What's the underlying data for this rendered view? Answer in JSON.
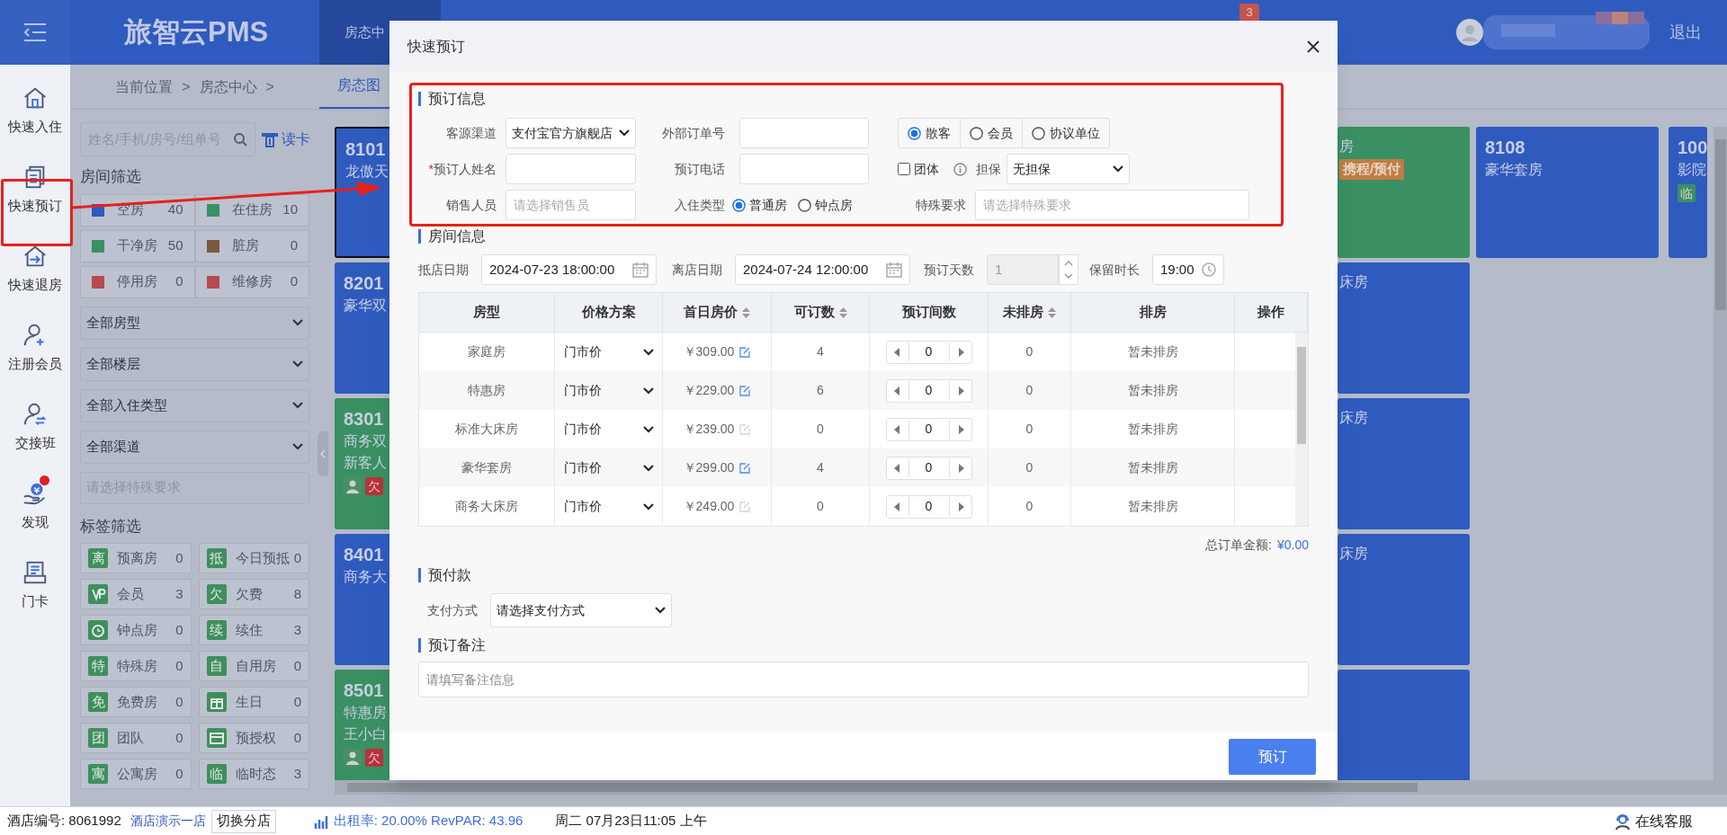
{
  "header": {
    "logo": "旅智云PMS",
    "tab": "房态中",
    "badge": "3",
    "logout": "退出"
  },
  "nav": [
    {
      "label": "快速入住",
      "dot": false
    },
    {
      "label": "快速预订",
      "dot": false
    },
    {
      "label": "快速退房",
      "dot": false
    },
    {
      "label": "注册会员",
      "dot": false
    },
    {
      "label": "交接班",
      "dot": false
    },
    {
      "label": "发现",
      "dot": true
    },
    {
      "label": "门卡",
      "dot": false
    }
  ],
  "filter": {
    "breadcrumb": [
      "当前位置",
      ">",
      "房态中心",
      ">"
    ],
    "search_placeholder": "姓名/手机/房号/组单号",
    "read_card": "读卡",
    "room_filter_title": "房间筛选",
    "statuses": [
      {
        "label": "空房",
        "count": "40",
        "color": "#2f5bbf"
      },
      {
        "label": "在住房",
        "count": "10",
        "color": "#3a9063"
      },
      {
        "label": "干净房",
        "count": "50",
        "color": "#3a9063"
      },
      {
        "label": "脏房",
        "count": "0",
        "color": "#7a5a3c"
      },
      {
        "label": "停用房",
        "count": "0",
        "color": "#b84a4f"
      },
      {
        "label": "维修房",
        "count": "0",
        "color": "#b84a4f"
      }
    ],
    "dropdowns": [
      "全部房型",
      "全部楼层",
      "全部入住类型",
      "全部渠道"
    ],
    "special_placeholder": "请选择特殊要求",
    "tag_filter_title": "标签筛选",
    "tags": [
      {
        "kind": "glyph",
        "glyph": "离",
        "label": "预离房",
        "count": "0"
      },
      {
        "kind": "glyph",
        "glyph": "抵",
        "label": "今日预抵",
        "count": "0"
      },
      {
        "kind": "vip",
        "label": "会员",
        "count": "3"
      },
      {
        "kind": "glyph",
        "glyph": "欠",
        "label": "欠费",
        "count": "8"
      },
      {
        "kind": "clock",
        "label": "钟点房",
        "count": "0"
      },
      {
        "kind": "glyph",
        "glyph": "续",
        "label": "续住",
        "count": "3"
      },
      {
        "kind": "glyph",
        "glyph": "特",
        "label": "特殊房",
        "count": "0"
      },
      {
        "kind": "glyph",
        "glyph": "自",
        "label": "自用房",
        "count": "0"
      },
      {
        "kind": "glyph",
        "glyph": "免",
        "label": "免费房",
        "count": "0"
      },
      {
        "kind": "gift",
        "label": "生日",
        "count": "0"
      },
      {
        "kind": "glyph",
        "glyph": "团",
        "label": "团队",
        "count": "0"
      },
      {
        "kind": "card",
        "label": "预授权",
        "count": "0"
      },
      {
        "kind": "glyph",
        "glyph": "寓",
        "label": "公寓房",
        "count": "0"
      },
      {
        "kind": "glyph",
        "glyph": "临",
        "label": "临时态",
        "count": "3"
      }
    ]
  },
  "room_view_tab": "房态图",
  "room_columns": [
    [
      {
        "number": "8101",
        "lines": [
          "龙傲天"
        ],
        "occupied": false,
        "selected": true
      },
      {
        "number": "8201",
        "lines": [
          "豪华双"
        ],
        "occupied": false,
        "selected": false
      },
      {
        "number": "8301",
        "lines": [
          "商务双",
          "新客人"
        ],
        "occupied": true,
        "selected": false,
        "tags": [
          {
            "kind": "guest",
            "color": "#4a8f66"
          },
          {
            "kind": "glyph",
            "glyph": "欠",
            "color": "#b8323c"
          }
        ]
      },
      {
        "number": "8401",
        "lines": [
          "商务大"
        ],
        "occupied": false,
        "selected": false
      },
      {
        "number": "8501",
        "lines": [
          "特惠房",
          "王小白"
        ],
        "occupied": true,
        "selected": false,
        "tags": [
          {
            "kind": "guest",
            "color": "#4a8f66"
          },
          {
            "kind": "glyph",
            "glyph": "欠",
            "color": "#b8323c"
          }
        ]
      }
    ],
    [
      {
        "lines": [
          "房"
        ],
        "badge": "携程/预付",
        "occupied": true,
        "selected": false
      },
      {
        "lines": [
          "床房"
        ],
        "occupied": false,
        "selected": false
      },
      {
        "lines": [
          "床房"
        ],
        "occupied": false,
        "selected": false
      },
      {
        "lines": [
          "床房"
        ],
        "occupied": false,
        "selected": false
      },
      {
        "occupied": false,
        "selected": false
      }
    ],
    [
      {
        "number": "8108",
        "lines": [
          "豪华套房"
        ],
        "occupied": false,
        "selected": false
      }
    ],
    [
      {
        "number": "100",
        "lines": [
          "影院"
        ],
        "occupied": false,
        "selected": false,
        "tags": [
          {
            "kind": "glyph",
            "glyph": "临",
            "color": "#3a9063"
          }
        ]
      }
    ]
  ],
  "modal": {
    "title": "快速预订",
    "booking": {
      "title": "预订信息",
      "source": {
        "label": "客源渠道",
        "value": "支付宝官方旗舰店"
      },
      "external_no": {
        "label": "外部订单号"
      },
      "guest_types": [
        {
          "label": "散客",
          "selected": true
        },
        {
          "label": "会员",
          "selected": false
        },
        {
          "label": "协议单位",
          "selected": false
        }
      ],
      "booker": {
        "label": "预订人姓名",
        "required_mark": "*"
      },
      "phone": {
        "label": "预订电话"
      },
      "group": {
        "label": "团体",
        "checked": false
      },
      "guarantee": {
        "label": "担保",
        "value": "无担保"
      },
      "sales": {
        "label": "销售人员",
        "placeholder": "请选择销售员"
      },
      "stay_type": {
        "label": "入住类型",
        "options": [
          {
            "label": "普通房",
            "selected": true
          },
          {
            "label": "钟点房",
            "selected": false
          }
        ]
      },
      "special": {
        "label": "特殊要求",
        "placeholder": "请选择特殊要求"
      }
    },
    "rooms": {
      "title": "房间信息",
      "arrival": {
        "label": "抵店日期",
        "value": "2024-07-23 18:00:00"
      },
      "departure": {
        "label": "离店日期",
        "value": "2024-07-24 12:00:00"
      },
      "nights": {
        "label": "预订天数",
        "value": "1",
        "disabled": true
      },
      "hold": {
        "label": "保留时长",
        "value": "19:00"
      },
      "columns": [
        {
          "label": "房型",
          "sortable": false
        },
        {
          "label": "价格方案",
          "sortable": false
        },
        {
          "label": "首日房价",
          "sortable": true
        },
        {
          "label": "可订数",
          "sortable": true
        },
        {
          "label": "预订间数",
          "sortable": false
        },
        {
          "label": "未排房",
          "sortable": true
        },
        {
          "label": "排房",
          "sortable": false
        },
        {
          "label": "操作",
          "sortable": false
        }
      ],
      "rows": [
        {
          "type": "家庭房",
          "plan": "门市价",
          "price": "￥309.00",
          "editable": true,
          "available": "4",
          "count": "0",
          "unassigned": "0",
          "assignment": "暂未排房"
        },
        {
          "type": "特惠房",
          "plan": "门市价",
          "price": "￥229.00",
          "editable": true,
          "available": "6",
          "count": "0",
          "unassigned": "0",
          "assignment": "暂未排房"
        },
        {
          "type": "标准大床房",
          "plan": "门市价",
          "price": "￥239.00",
          "editable": false,
          "available": "0",
          "count": "0",
          "unassigned": "0",
          "assignment": "暂未排房"
        },
        {
          "type": "豪华套房",
          "plan": "门市价",
          "price": "￥299.00",
          "editable": true,
          "available": "4",
          "count": "0",
          "unassigned": "0",
          "assignment": "暂未排房"
        },
        {
          "type": "商务大床房",
          "plan": "门市价",
          "price": "￥249.00",
          "editable": false,
          "available": "0",
          "count": "0",
          "unassigned": "0",
          "assignment": "暂未排房"
        }
      ]
    },
    "total": {
      "label": "总订单金额:",
      "value": "¥0.00"
    },
    "prepay": {
      "title": "预付款",
      "label": "支付方式",
      "value": "请选择支付方式"
    },
    "remark": {
      "title": "预订备注",
      "placeholder": "请填写备注信息"
    },
    "submit": "预订"
  },
  "status_bar": {
    "hotel_no": "酒店编号: 8061992",
    "hotel_name": "酒店演示一店",
    "switch": "切换分店",
    "occupancy": "出租率: 20.00% RevPAR: 43.96",
    "datetime": "周二 07月23日11:05 上午",
    "support": "在线客服"
  }
}
